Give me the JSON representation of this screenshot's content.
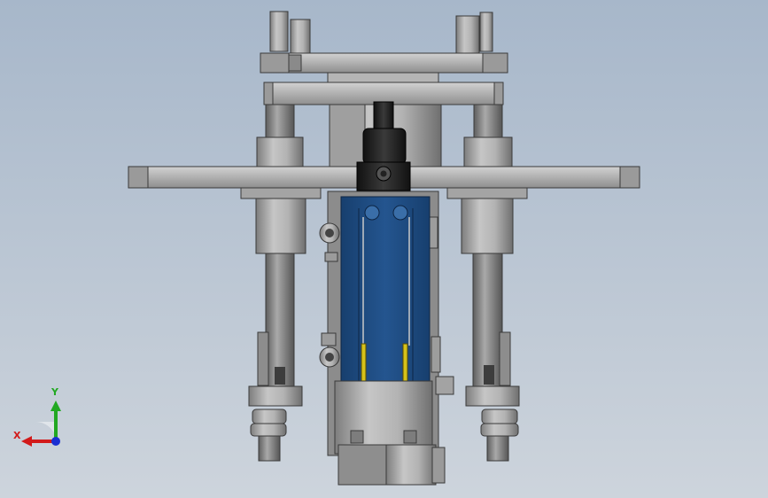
{
  "viewport": {
    "background_top": "#a7b7ca",
    "background_bottom": "#cdd4dc"
  },
  "model": {
    "colors": {
      "steel_light": "#c9c9c9",
      "steel_mid": "#a8a8a8",
      "steel_dark": "#7a7a7a",
      "outline": "#3a3a3a",
      "cylinder_blue": "#1f4f86",
      "sensor_yellow": "#d6c21a",
      "block_black": "#1e1e1e"
    }
  },
  "triad": {
    "x_label": "X",
    "y_label": "Y",
    "x_color": "#d21a1a",
    "y_color": "#22a822",
    "z_color": "#1a2fd2"
  }
}
